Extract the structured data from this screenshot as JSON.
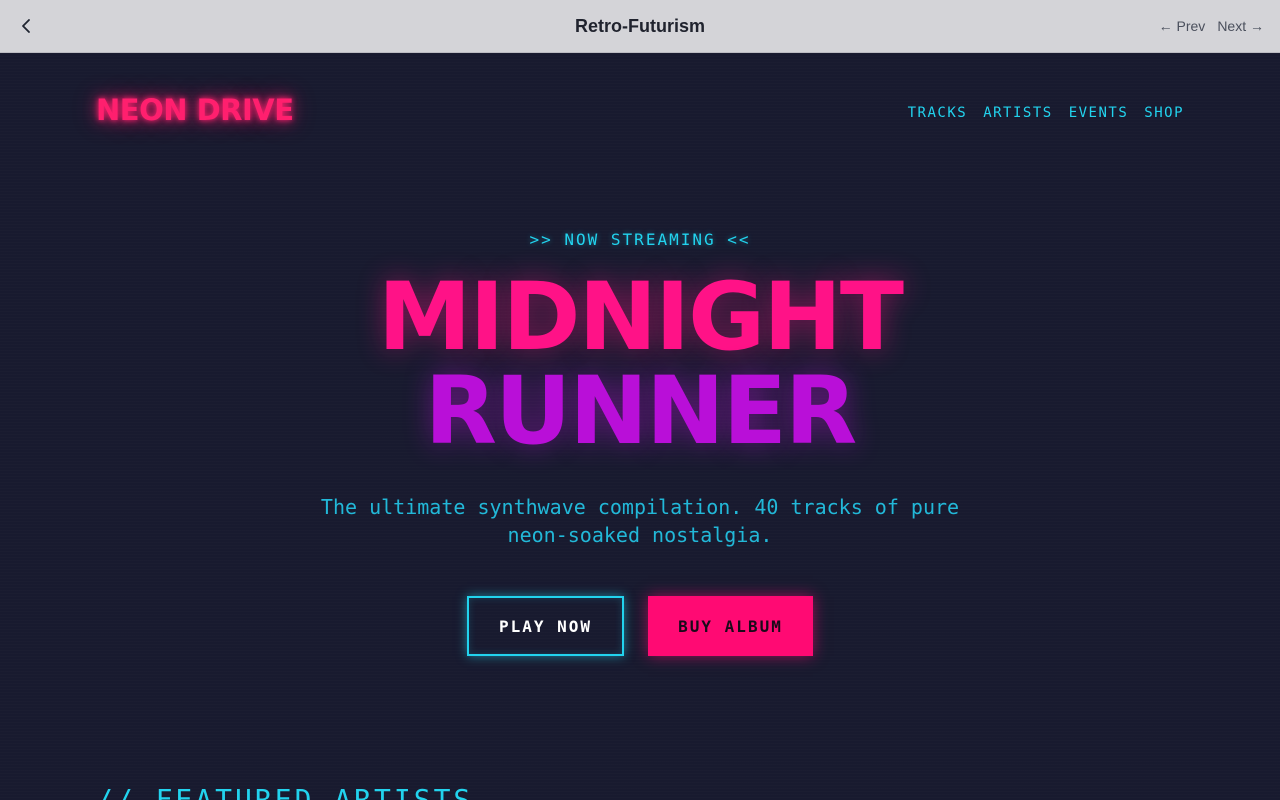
{
  "window": {
    "title": "Retro-Futurism",
    "prev_label": "← Prev",
    "next_label": "Next →"
  },
  "site": {
    "logo": "NEON DRIVE",
    "nav": [
      {
        "label": "TRACKS"
      },
      {
        "label": "ARTISTS"
      },
      {
        "label": "EVENTS"
      },
      {
        "label": "SHOP"
      }
    ]
  },
  "hero": {
    "eyebrow": ">> NOW STREAMING <<",
    "title_line1": "MIDNIGHT",
    "title_line2": "RUNNER",
    "subtitle": "The ultimate synthwave compilation. 40 tracks of pure neon-soaked nostalgia.",
    "play_label": "PLAY NOW",
    "buy_label": "BUY ALBUM"
  },
  "featured": {
    "heading": "// FEATURED ARTISTS"
  },
  "colors": {
    "neon_pink": "#ff1f6e",
    "neon_cyan": "#22d3ee",
    "neon_purple": "#b90fd8",
    "background": "#181a2f"
  }
}
